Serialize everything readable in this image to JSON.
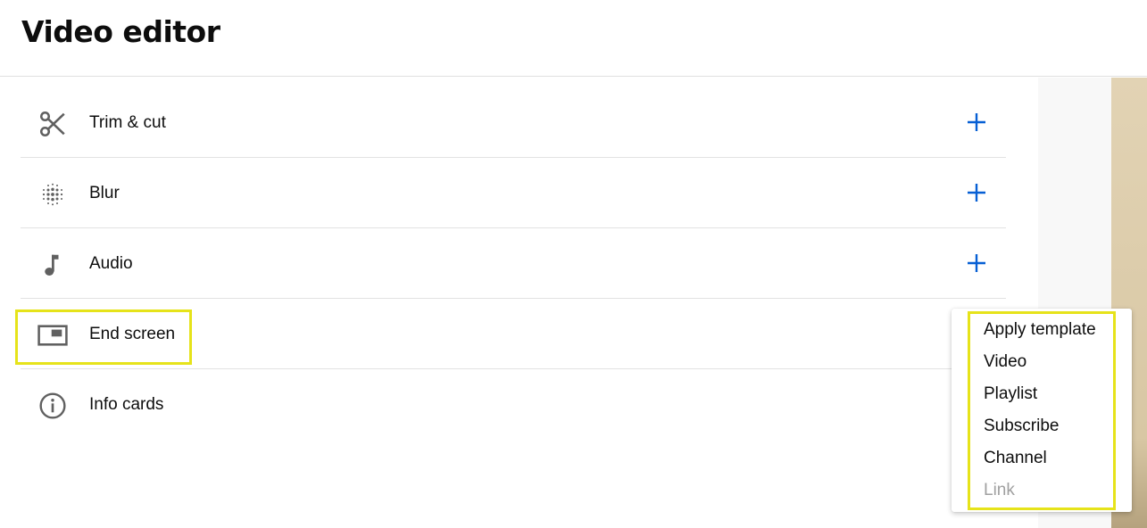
{
  "header": {
    "title": "Video editor"
  },
  "tools": [
    {
      "label": "Trim & cut",
      "icon": "scissors-icon",
      "has_add": true
    },
    {
      "label": "Blur",
      "icon": "blur-icon",
      "has_add": true
    },
    {
      "label": "Audio",
      "icon": "music-note-icon",
      "has_add": true
    },
    {
      "label": "End screen",
      "icon": "end-screen-icon",
      "has_add": false
    },
    {
      "label": "Info cards",
      "icon": "info-icon",
      "has_add": false
    }
  ],
  "end_screen_menu": {
    "items": [
      {
        "label": "Apply template",
        "enabled": true
      },
      {
        "label": "Video",
        "enabled": true
      },
      {
        "label": "Playlist",
        "enabled": true
      },
      {
        "label": "Subscribe",
        "enabled": true
      },
      {
        "label": "Channel",
        "enabled": true
      },
      {
        "label": "Link",
        "enabled": false
      }
    ]
  },
  "colors": {
    "accent_blue": "#065fd4",
    "icon_gray": "#606060",
    "highlight_yellow": "#e6e31a",
    "disabled_text": "#a0a0a0"
  }
}
